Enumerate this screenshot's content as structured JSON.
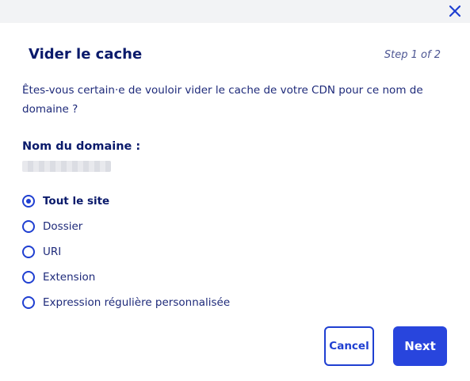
{
  "header": {
    "close_icon": "close-icon",
    "title": "Vider le cache",
    "step": "Step 1 of 2"
  },
  "body": {
    "question": "Êtes-vous certain·e de vouloir vider le cache de votre CDN pour ce nom de domaine ?",
    "domain_label": "Nom du domaine :"
  },
  "options": {
    "selected_index": 0,
    "items": [
      {
        "label": "Tout le site"
      },
      {
        "label": "Dossier"
      },
      {
        "label": "URI"
      },
      {
        "label": "Extension"
      },
      {
        "label": "Expression régulière personnalisée"
      }
    ]
  },
  "footer": {
    "cancel_label": "Cancel",
    "next_label": "Next"
  },
  "colors": {
    "accent": "#2845dd",
    "title": "#0a1a6b",
    "text": "#1e2a7a",
    "topbar": "#f2f3f5"
  }
}
